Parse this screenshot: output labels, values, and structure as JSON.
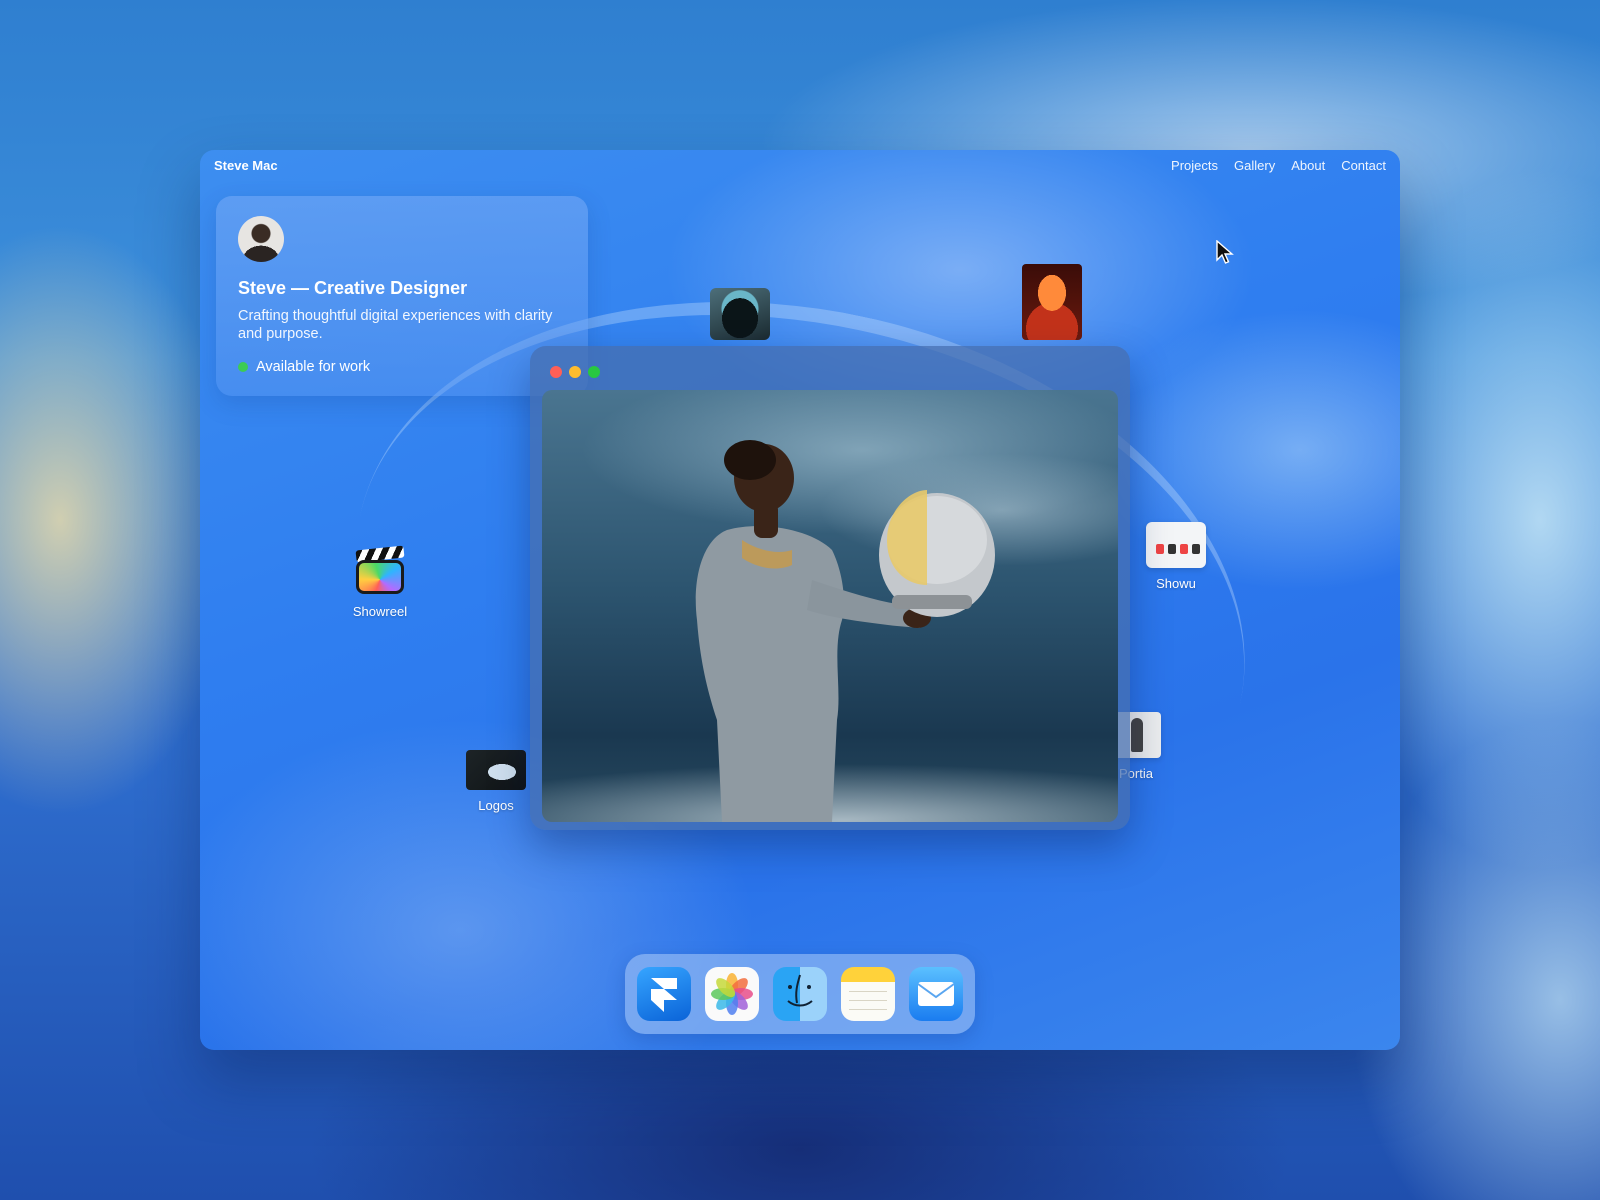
{
  "menubar": {
    "brand": "Steve Mac",
    "nav": [
      "Projects",
      "Gallery",
      "About",
      "Contact"
    ]
  },
  "profile": {
    "name": "Steve — Creative Designer",
    "tagline": "Crafting thoughtful digital experiences with clarity and purpose.",
    "status": "Available for work",
    "status_color": "#3ccb55"
  },
  "desktop_icons": {
    "showreel": "Showreel",
    "logos": "Logos",
    "showu": "Showu",
    "portia": "Portia"
  },
  "window": {
    "controls": [
      "close",
      "minimize",
      "zoom"
    ]
  },
  "dock": {
    "apps": [
      "framer-icon",
      "photos-icon",
      "finder-icon",
      "notes-icon",
      "mail-icon"
    ]
  },
  "colors": {
    "accent": "#2f7ef0",
    "close": "#ff5f57",
    "minimize": "#febc2e",
    "zoom": "#28c840"
  }
}
